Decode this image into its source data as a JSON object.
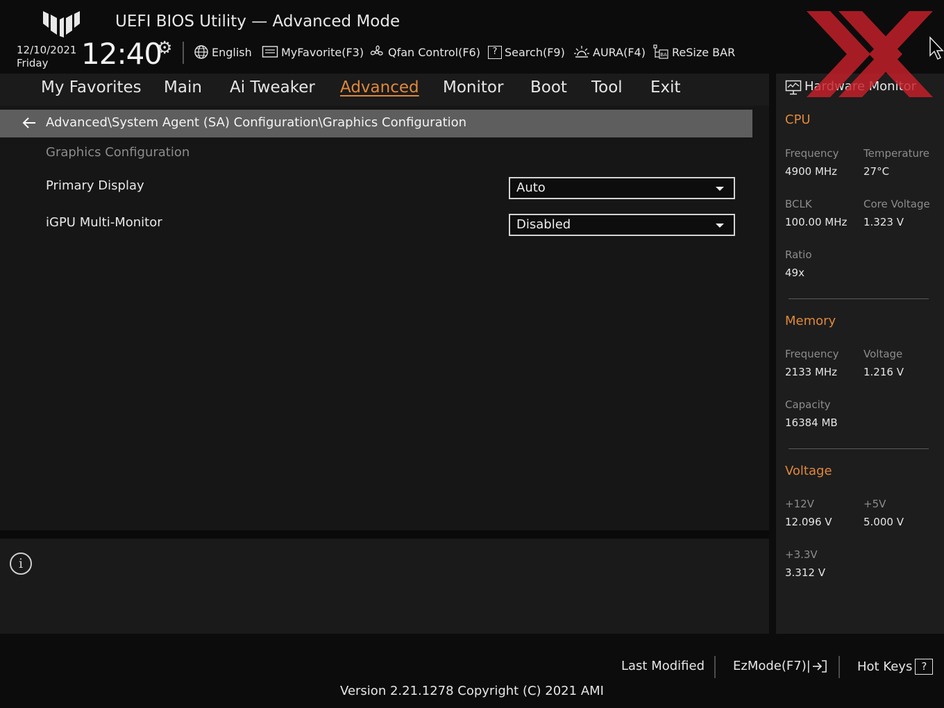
{
  "header": {
    "title": "UEFI BIOS Utility — Advanced Mode",
    "date": "12/10/2021",
    "day": "Friday",
    "time": "12:40",
    "tools": {
      "language": "English",
      "my_favorite": "MyFavorite(F3)",
      "qfan": "Qfan Control(F6)",
      "search": "Search(F9)",
      "aura": "AURA(F4)",
      "resize_bar": "ReSize BAR"
    },
    "icons": [
      "tuf-logo-icon",
      "gear-icon",
      "globe-icon",
      "favorite-icon",
      "fan-icon",
      "help-box-icon",
      "aura-light-icon",
      "resize-bar-icon"
    ]
  },
  "menu": {
    "items": [
      "My Favorites",
      "Main",
      "Ai Tweaker",
      "Advanced",
      "Monitor",
      "Boot",
      "Tool",
      "Exit"
    ],
    "active": "Advanced"
  },
  "main": {
    "breadcrumb": "Advanced\\System Agent (SA) Configuration\\Graphics Configuration",
    "section_title": "Graphics Configuration",
    "settings": [
      {
        "label": "Primary Display",
        "value": "Auto"
      },
      {
        "label": "iGPU Multi-Monitor",
        "value": "Disabled"
      }
    ]
  },
  "hardware_monitor": {
    "title": "Hardware Monitor",
    "cpu": {
      "heading": "CPU",
      "frequency_label": "Frequency",
      "frequency": "4900 MHz",
      "temperature_label": "Temperature",
      "temperature": "27°C",
      "bclk_label": "BCLK",
      "bclk": "100.00 MHz",
      "core_voltage_label": "Core Voltage",
      "core_voltage": "1.323 V",
      "ratio_label": "Ratio",
      "ratio": "49x"
    },
    "memory": {
      "heading": "Memory",
      "frequency_label": "Frequency",
      "frequency": "2133 MHz",
      "voltage_label": "Voltage",
      "voltage": "1.216 V",
      "capacity_label": "Capacity",
      "capacity": "16384 MB"
    },
    "voltage": {
      "heading": "Voltage",
      "v12_label": "+12V",
      "v12": "12.096 V",
      "v5_label": "+5V",
      "v5": "5.000 V",
      "v33_label": "+3.3V",
      "v33": "3.312 V"
    }
  },
  "footer": {
    "last_modified": "Last Modified",
    "ezmode": "EzMode(F7)|",
    "hotkeys": "Hot Keys",
    "hotkeys_key": "?",
    "version": "Version 2.21.1278 Copyright (C) 2021 AMI"
  },
  "colors": {
    "accent": "#e0883a",
    "background": "#111111",
    "breadcrumb_bar": "#5e5e5e",
    "watermark": "#c8202a"
  }
}
